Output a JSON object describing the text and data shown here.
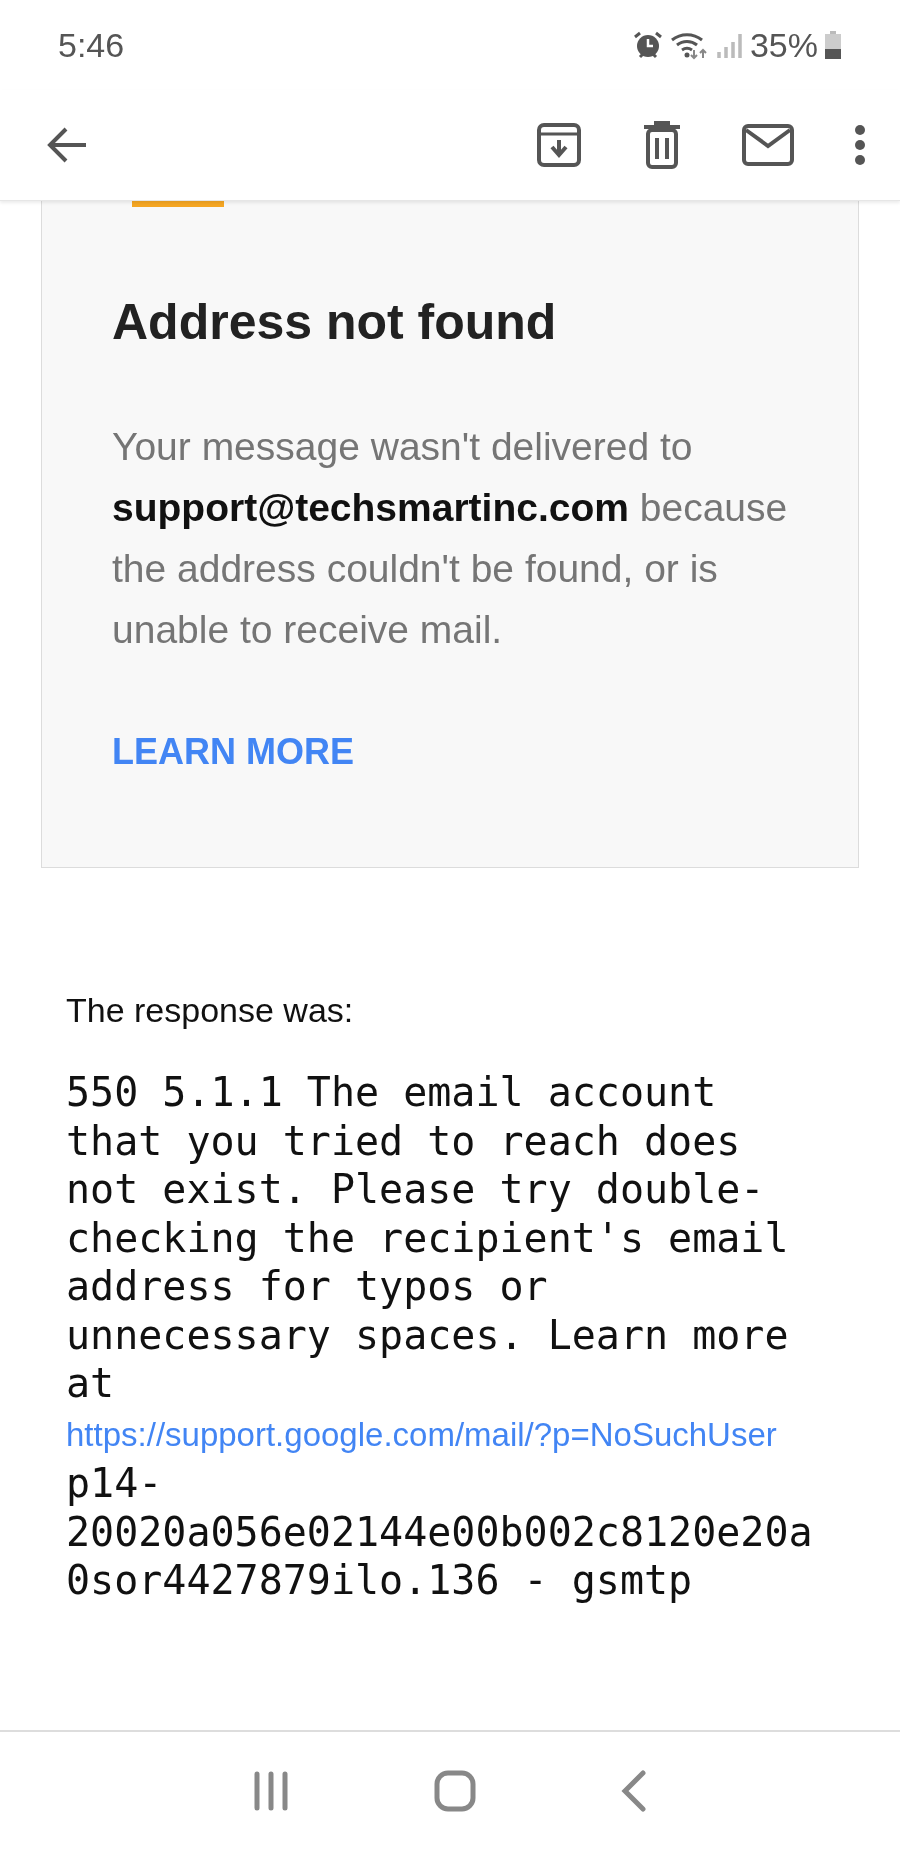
{
  "status_bar": {
    "time": "5:46",
    "battery": "35%"
  },
  "card": {
    "title": "Address not found",
    "message": "Your message wasn't delivered to **support@techsmartinc.com** because the address couldn't be found, or is unable to receive mail.",
    "link": "LEARN MORE"
  },
  "response": {
    "label": "The response was:",
    "text_before": "550 5.1.1 The email account that you tried to reach does not exist. Please try double-checking the recipient's email address for typos or unnecessary spaces. Learn more at",
    "link": "https://support.google.com/mail/?p=NoSuchUser",
    "text_after": "p14-20020a056e02144e00b002c8120e20a0sor4427879ilo.136 - gsmtp"
  }
}
